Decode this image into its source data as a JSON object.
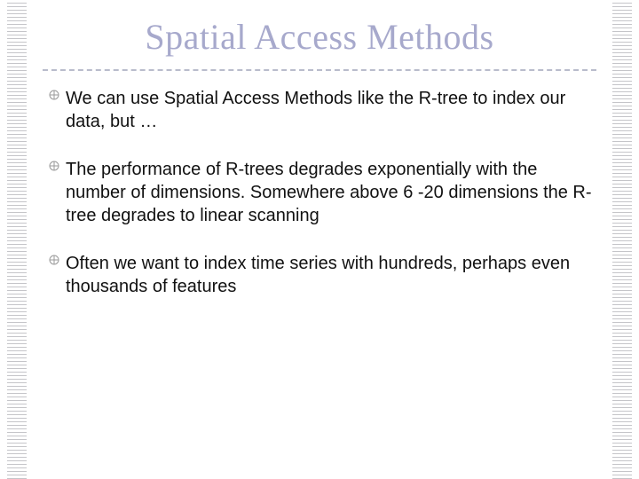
{
  "title": "Spatial Access Methods",
  "bullets": [
    "We  can use Spatial Access Methods like the R-tree to index our data, but …",
    "The performance of R-trees degrades exponentially with the number of dimensions. Somewhere above 6 -20 dimensions the R-tree degrades to linear scanning",
    "Often we want to index time series with hundreds, perhaps even thousands of features"
  ]
}
